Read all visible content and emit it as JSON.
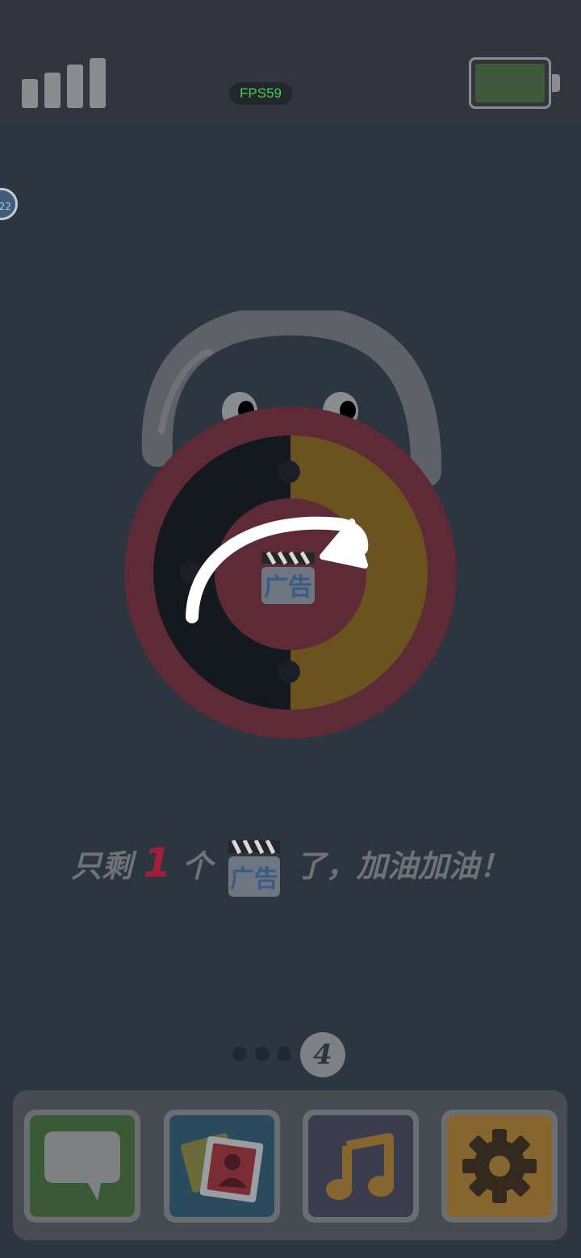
{
  "status_bar": {
    "fps_label": "FPS59",
    "icons": [
      "signal-icon",
      "battery-icon"
    ]
  },
  "level_badge": "22",
  "lock": {
    "icon": "padlock-icon",
    "center_badge": "广告",
    "arrow": "rotate-arrow-icon",
    "colors": {
      "body": "#5e2a36",
      "left_half": "#14181f",
      "right_half": "#6a531e",
      "shackle": "#5e6166"
    }
  },
  "message": {
    "prefix": "只剩",
    "count": "1",
    "mid": "个",
    "ad_word": "广告",
    "suffix": "了，加油加油！"
  },
  "pager": {
    "dots": 3,
    "current": "4"
  },
  "dock": {
    "apps": [
      {
        "name": "messages",
        "icon": "chat-bubble-icon",
        "color": "#3a5a36"
      },
      {
        "name": "photos",
        "icon": "photos-icon",
        "color": "#2a4a5e"
      },
      {
        "name": "music",
        "icon": "music-note-icon",
        "color": "#3b3d4e"
      },
      {
        "name": "settings",
        "icon": "gear-icon",
        "color": "#86662e"
      }
    ]
  }
}
